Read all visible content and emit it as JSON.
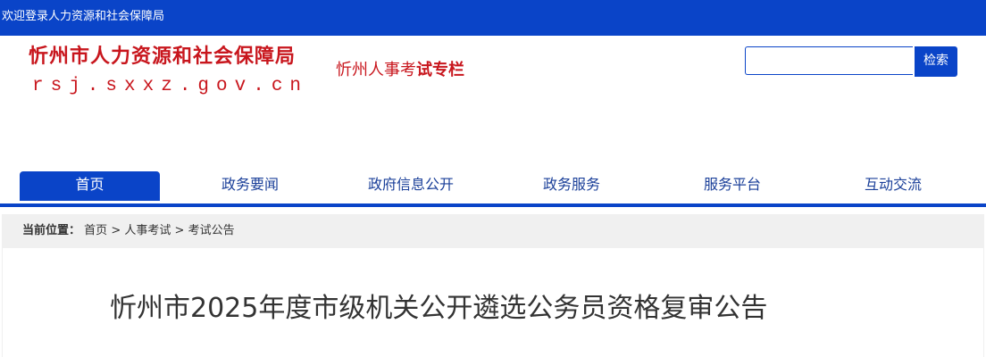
{
  "topbar": {
    "welcome_text": "欢迎登录人力资源和社会保障局"
  },
  "header": {
    "logo_name": "忻州市人力资源和社会保障局",
    "logo_url": "rsj.sxxz.gov.cn",
    "exam_link_prefix": "忻州人事考",
    "exam_link_bold": "试专栏"
  },
  "search": {
    "placeholder": "",
    "button_label": "检索"
  },
  "nav": {
    "items": [
      {
        "label": "首页",
        "active": true
      },
      {
        "label": "政务要闻",
        "active": false
      },
      {
        "label": "政府信息公开",
        "active": false
      },
      {
        "label": "政务服务",
        "active": false
      },
      {
        "label": "服务平台",
        "active": false
      },
      {
        "label": "互动交流",
        "active": false
      }
    ]
  },
  "breadcrumb": {
    "label": "当前位置：",
    "items": [
      "首页",
      "人事考试",
      "考试公告"
    ],
    "separator": ">"
  },
  "article": {
    "title": "忻州市2025年度市级机关公开遴选公务员资格复审公告"
  },
  "colors": {
    "brand_blue": "#0a44c8",
    "brand_red": "#c8161d"
  }
}
